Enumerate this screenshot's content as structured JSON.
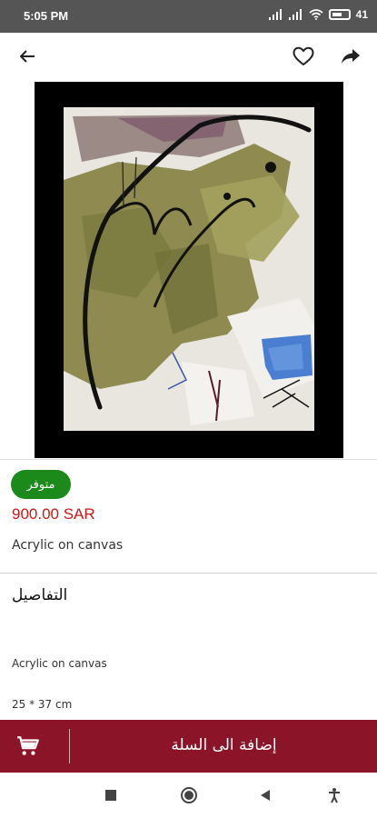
{
  "status_bar": {
    "time": "5:05 PM",
    "battery": "41"
  },
  "top_bar": {
    "icons": [
      "arrow-left-icon",
      "heart-icon",
      "share-icon"
    ]
  },
  "product": {
    "availability_badge": "متوفر",
    "price": "900.00 SAR",
    "subtitle": "Acrylic on canvas"
  },
  "details": {
    "heading": "التفاصيل",
    "description": "Acrylic on canvas",
    "dimensions": "25 * 37 cm"
  },
  "cart_bar": {
    "label": "إضافة الى السلة"
  },
  "colors": {
    "accent": "#8b1428",
    "badge": "#1b8a1b",
    "price": "#d01717"
  }
}
